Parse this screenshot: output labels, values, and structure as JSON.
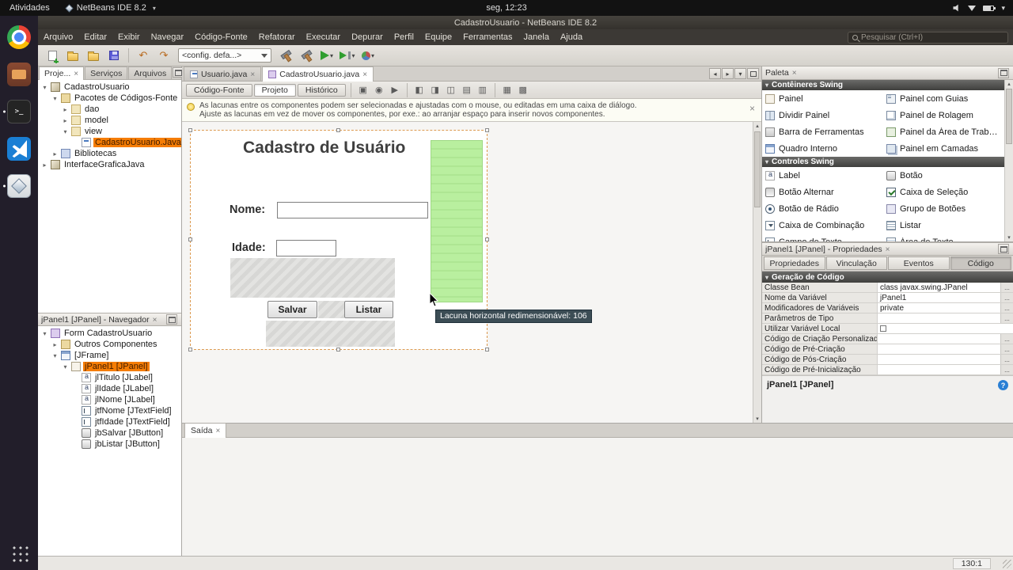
{
  "colors": {
    "selection_orange": "#f57d05",
    "gap_green": "#b9ef9f",
    "tooltip_bg": "#3c4d55"
  },
  "desktop": {
    "topbar": {
      "activities": "At​ividades",
      "app_name": "NetBeans IDE 8.2",
      "clock": "seg, 12:23"
    },
    "dock": {
      "items": [
        {
          "name": "dock-chrome",
          "icon": "chrome"
        },
        {
          "name": "dock-files",
          "icon": "files"
        },
        {
          "name": "dock-terminal",
          "icon": "terminal",
          "running": true
        },
        {
          "name": "dock-vscode",
          "icon": "vscode"
        },
        {
          "name": "dock-netbeans",
          "icon": "netbeans",
          "running": true
        }
      ]
    }
  },
  "window": {
    "title": "CadastroUsuario - NetBeans IDE 8.2"
  },
  "menubar": {
    "items": [
      "Arquivo",
      "Editar",
      "Exibir",
      "Navegar",
      "Código-Fonte",
      "Refatorar",
      "Executar",
      "Depurar",
      "Perfil",
      "Equipe",
      "Ferramentas",
      "Janela",
      "Ajuda"
    ],
    "search_placeholder": "Pesquisar (Ctrl+I)"
  },
  "toolbar": {
    "config_value": "<config. defa...>"
  },
  "projects": {
    "tabs": [
      {
        "label": "Proje...",
        "close": true,
        "active": true
      },
      {
        "label": "Serviços"
      },
      {
        "label": "Arquivos"
      }
    ],
    "tree": [
      {
        "label": "CadastroUsuario",
        "indent": 0,
        "exp": "open",
        "icon": "project"
      },
      {
        "label": "Pacotes de Códigos-Fonte",
        "indent": 1,
        "exp": "open",
        "icon": "srcfolder"
      },
      {
        "label": "dao",
        "indent": 2,
        "exp": "closed",
        "icon": "package"
      },
      {
        "label": "model",
        "indent": 2,
        "exp": "closed",
        "icon": "package"
      },
      {
        "label": "view",
        "indent": 2,
        "exp": "open",
        "icon": "package"
      },
      {
        "label": "CadastroUsuario.Java",
        "indent": 3,
        "icon": "javafile",
        "selected": true
      },
      {
        "label": "Bibliotecas",
        "indent": 1,
        "exp": "closed",
        "icon": "libraries"
      },
      {
        "label": "InterfaceGraficaJava",
        "indent": 0,
        "exp": "closed",
        "icon": "project"
      }
    ]
  },
  "navigator": {
    "title": "jPanel1 [JPanel] - Navegador",
    "tree": [
      {
        "label": "Form CadastroUsuario",
        "indent": 0,
        "exp": "open",
        "icon": "form"
      },
      {
        "label": "Outros Componentes",
        "indent": 1,
        "exp": "closed",
        "icon": "category"
      },
      {
        "label": "[JFrame]",
        "indent": 1,
        "exp": "open",
        "icon": "frame"
      },
      {
        "label": "jPanel1 [JPanel]",
        "indent": 2,
        "exp": "open",
        "icon": "panel",
        "selected": true
      },
      {
        "label": "jlTitulo [JLabel]",
        "indent": 3,
        "icon": "label"
      },
      {
        "label": "jlIdade [JLabel]",
        "indent": 3,
        "icon": "label"
      },
      {
        "label": "jlNome [JLabel]",
        "indent": 3,
        "icon": "label"
      },
      {
        "label": "jtfNome [JTextField]",
        "indent": 3,
        "icon": "textfield"
      },
      {
        "label": "jtfIdade [JTextField]",
        "indent": 3,
        "icon": "textfield"
      },
      {
        "label": "jbSalvar [JButton]",
        "indent": 3,
        "icon": "button"
      },
      {
        "label": "jbListar [JButton]",
        "indent": 3,
        "icon": "button"
      }
    ]
  },
  "editor": {
    "doc_tabs": [
      {
        "label": "Usuario.java",
        "close": true,
        "icon": "javafile"
      },
      {
        "label": "CadastroUsuario.java",
        "close": true,
        "icon": "form",
        "active": true
      }
    ],
    "view_tabs": [
      {
        "label": "Código-Fonte"
      },
      {
        "label": "Projeto",
        "active": true
      },
      {
        "label": "Histórico"
      }
    ],
    "hint": {
      "line1": "As lacunas entre os componentes podem ser selecionadas e ajustadas com o mouse, ou editadas em uma caixa de diálogo.",
      "line2": "Ajuste as lacunas em vez de mover os componentes, por exe.: ao arranjar espaço para inserir novos componentes."
    },
    "form": {
      "title": "Cadastro de Usuário",
      "nome_label": "Nome:",
      "idade_label": "Idade:",
      "salvar_button": "Salvar",
      "listar_button": "Listar",
      "tooltip": "Lacuna horizontal redimensionável: 106"
    }
  },
  "palette": {
    "title": "Paleta",
    "sections": [
      {
        "title": "Contêineres Swing",
        "items": [
          {
            "label": "Painel",
            "icon": "panel"
          },
          {
            "label": "Painel com Guias",
            "icon": "tabbedpane"
          },
          {
            "label": "Dividir Painel",
            "icon": "splitpane"
          },
          {
            "label": "Painel de Rolagem",
            "icon": "scrollpane"
          },
          {
            "label": "Barra de Ferramentas",
            "icon": "toolbar"
          },
          {
            "label": "Painel da Área de Trabalho",
            "icon": "desktoppane"
          },
          {
            "label": "Quadro Interno",
            "icon": "internalframe"
          },
          {
            "label": "Painel em Camadas",
            "icon": "layeredpane"
          }
        ]
      },
      {
        "title": "Controles Swing",
        "items": [
          {
            "label": "Label",
            "icon": "label"
          },
          {
            "label": "Botão",
            "icon": "button"
          },
          {
            "label": "Botão Alternar",
            "icon": "togglebutton"
          },
          {
            "label": "Caixa de Seleção",
            "icon": "checkbox"
          },
          {
            "label": "Botão de Rádio",
            "icon": "radiobutton"
          },
          {
            "label": "Grupo de Botões",
            "icon": "buttongroup"
          },
          {
            "label": "Caixa de Combinação",
            "icon": "combobox"
          },
          {
            "label": "Listar",
            "icon": "list"
          },
          {
            "label": "Campo de Texto",
            "icon": "textfield"
          },
          {
            "label": "Área de Texto",
            "icon": "textarea"
          }
        ]
      }
    ]
  },
  "properties": {
    "title": "jPanel1 [JPanel] - Propriedades",
    "tabs": [
      {
        "label": "Propriedades"
      },
      {
        "label": "Vinculação"
      },
      {
        "label": "Eventos"
      },
      {
        "label": "Código",
        "active": true
      }
    ],
    "section": "Geração de Código",
    "rows": [
      {
        "label": "Classe Bean",
        "value": "class javax.swing.JPanel",
        "ctrl": "dots"
      },
      {
        "label": "Nome da Variável",
        "value": "jPanel1",
        "ctrl": "dots"
      },
      {
        "label": "Modificadores de Variáveis",
        "value": "private",
        "ctrl": "dots"
      },
      {
        "label": "Parâmetros de Tipo",
        "value": "",
        "ctrl": "dots"
      },
      {
        "label": "Utilizar Variável Local",
        "value": "",
        "ctrl": "check"
      },
      {
        "label": "Código de Criação Personalizado",
        "value": "",
        "ctrl": "dots"
      },
      {
        "label": "Código de Pré-Criação",
        "value": "",
        "ctrl": "dots"
      },
      {
        "label": "Código de Pós-Criação",
        "value": "",
        "ctrl": "dots"
      },
      {
        "label": "Código de Pré-Inicialização",
        "value": "",
        "ctrl": "dots"
      }
    ],
    "footer": "jPanel1 [JPanel]"
  },
  "output": {
    "tab": "Saída"
  },
  "statusbar": {
    "caret": "130:1"
  }
}
